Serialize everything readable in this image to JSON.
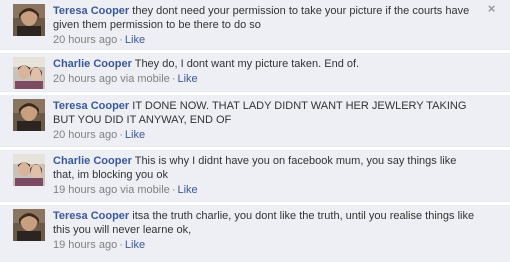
{
  "comments": [
    {
      "author": "Teresa Cooper",
      "text": "they dont need your permission to take your picture if the courts have given them permission to be there to do so",
      "time": "20 hours ago",
      "via": "",
      "like": "Like",
      "close": "×"
    },
    {
      "author": "Charlie Cooper",
      "text": "They do, I dont want my picture taken. End of.",
      "time": "20 hours ago",
      "via": "via mobile",
      "like": "Like"
    },
    {
      "author": "Teresa Cooper",
      "text": "IT DONE NOW. THAT LADY DIDNT WANT HER JEWLERY TAKING BUT YOU DID IT ANYWAY, END OF",
      "time": "20 hours ago",
      "via": "",
      "like": "Like"
    },
    {
      "author": "Charlie Cooper",
      "text": "This is why I didnt have you on facebook mum, you say things like that, im blocking you ok",
      "time": "19 hours ago",
      "via": "via mobile",
      "like": "Like"
    },
    {
      "author": "Teresa Cooper",
      "text": "itsa the truth charlie, you dont like the truth, until you realise things like this you will never learne ok,",
      "time": "19 hours ago",
      "via": "",
      "like": "Like"
    }
  ],
  "separator": "·",
  "colors": {
    "background": "#edeff4",
    "author": "#3b5998",
    "meta": "#808080"
  }
}
